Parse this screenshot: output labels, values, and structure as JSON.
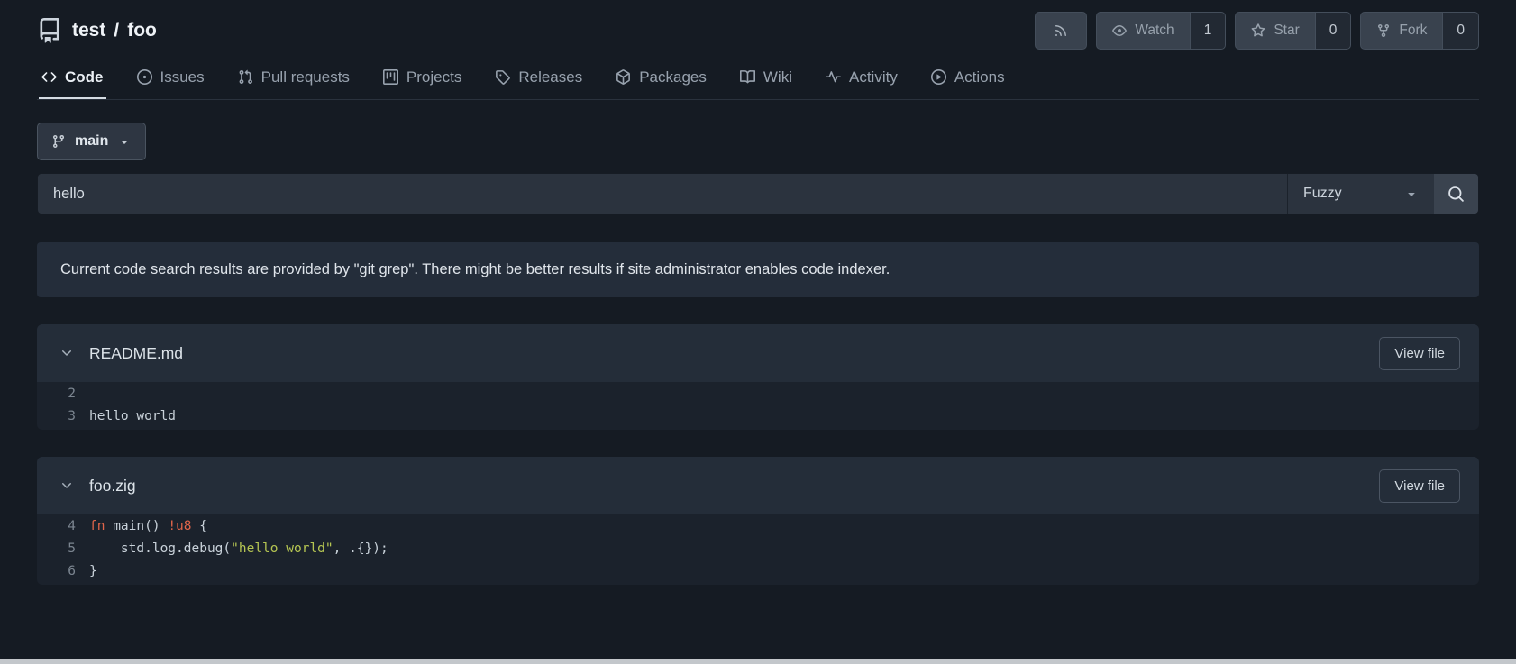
{
  "repo_header": {
    "owner": "test",
    "separator": "/",
    "name": "foo",
    "buttons": {
      "rss": {
        "icon": "rss"
      },
      "watch": {
        "icon": "eye",
        "label": "Watch",
        "count": "1"
      },
      "star": {
        "icon": "star",
        "label": "Star",
        "count": "0"
      },
      "fork": {
        "icon": "git-fork",
        "label": "Fork",
        "count": "0"
      }
    }
  },
  "tabs": [
    {
      "label": "Code",
      "icon": "code",
      "active": true
    },
    {
      "label": "Issues",
      "icon": "issue-opened",
      "active": false
    },
    {
      "label": "Pull requests",
      "icon": "git-pull-request",
      "active": false
    },
    {
      "label": "Projects",
      "icon": "project",
      "active": false
    },
    {
      "label": "Releases",
      "icon": "tag",
      "active": false
    },
    {
      "label": "Packages",
      "icon": "package",
      "active": false
    },
    {
      "label": "Wiki",
      "icon": "book",
      "active": false
    },
    {
      "label": "Activity",
      "icon": "pulse",
      "active": false
    },
    {
      "label": "Actions",
      "icon": "play",
      "active": false
    }
  ],
  "branch_selector": {
    "icon": "git-branch",
    "label": "main"
  },
  "search": {
    "value": "hello",
    "mode_selected": "Fuzzy",
    "search_icon": "search"
  },
  "notice_text": "Current code search results are provided by \"git grep\". There might be better results if site administrator enables code indexer.",
  "code_colors": {
    "default": "#c9d2da",
    "keyword": "#e0654a",
    "string": "#b5c552",
    "line_number": "#7b8590"
  },
  "results": [
    {
      "filename": "README.md",
      "view_file_label": "View file",
      "lines": [
        {
          "number": "2",
          "segments": []
        },
        {
          "number": "3",
          "segments": [
            {
              "type": "default",
              "text": "hello world"
            }
          ]
        }
      ]
    },
    {
      "filename": "foo.zig",
      "view_file_label": "View file",
      "lines": [
        {
          "number": "4",
          "segments": [
            {
              "type": "keyword",
              "text": "fn"
            },
            {
              "type": "default",
              "text": " main() "
            },
            {
              "type": "keyword",
              "text": "!u8"
            },
            {
              "type": "default",
              "text": " {"
            }
          ]
        },
        {
          "number": "5",
          "segments": [
            {
              "type": "default",
              "text": "    std.log.debug("
            },
            {
              "type": "string",
              "text": "\"hello world\""
            },
            {
              "type": "default",
              "text": ", .{});"
            }
          ]
        },
        {
          "number": "6",
          "segments": [
            {
              "type": "default",
              "text": "}"
            }
          ]
        }
      ]
    }
  ]
}
